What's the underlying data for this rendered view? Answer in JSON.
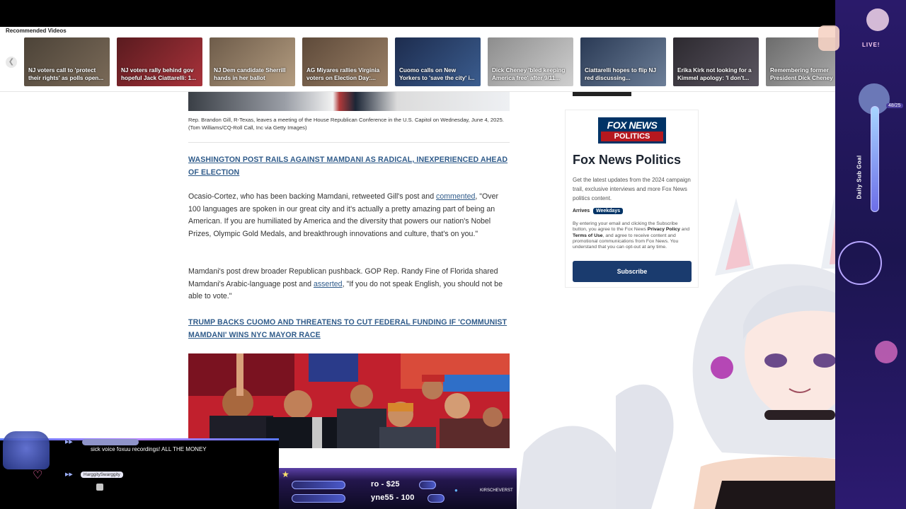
{
  "recommended": {
    "title": "Recommended Videos",
    "prev_icon": "chevron-left-icon",
    "items": [
      {
        "caption": "NJ voters call to 'protect their rights' as polls open...",
        "colors": [
          "#4c4338",
          "#7a6a58"
        ]
      },
      {
        "caption": "NJ voters rally behind gov hopeful Jack Ciattarelli: 1...",
        "colors": [
          "#5a1b1f",
          "#a8323a"
        ]
      },
      {
        "caption": "NJ Dem candidate Sherrill hands in her ballot",
        "colors": [
          "#6e5c4a",
          "#b39c80"
        ]
      },
      {
        "caption": "AG Miyares rallies Virginia voters on Election Day:...",
        "colors": [
          "#5e4a3a",
          "#9a8066"
        ]
      },
      {
        "caption": "Cuomo calls on New Yorkers to 'save the city' i...",
        "colors": [
          "#1d2c4e",
          "#3b5d8f"
        ]
      },
      {
        "caption": "Dick Cheney 'bled keeping America free' after 9/11...",
        "colors": [
          "#8d8d8d",
          "#cfcfcf"
        ]
      },
      {
        "caption": "Ciattarelli hopes to flip NJ red discussing...",
        "colors": [
          "#2a3a55",
          "#6d7f98"
        ]
      },
      {
        "caption": "Erika Kirk not looking for a Kimmel apology: 'I don't...",
        "colors": [
          "#2d2a30",
          "#5a5560"
        ]
      },
      {
        "caption": "Remembering former President Dick Cheney",
        "colors": [
          "#6c6c6c",
          "#b0b0b0"
        ]
      }
    ]
  },
  "article": {
    "photo_caption": "Rep. Brandon Gill, R-Texas, leaves a meeting of the House Republican Conference in the U.S. Capitol on Wednesday, June 4, 2025. (Tom Williams/CQ-Roll Call, Inc via Getty Images)",
    "link1": "WASHINGTON POST RAILS AGAINST MAMDANI AS RADICAL, INEXPERIENCED AHEAD OF ELECTION",
    "para1_before": "Ocasio-Cortez, who has been backing Mamdani, retweeted Gill's post and ",
    "para1_link": "commented",
    "para1_after": ", \"Over 100 languages are spoken in our great city and it's actually a pretty amazing part of being an American. If you are humiliated by America and the diversity that powers our nation's Nobel Prizes, Olympic Gold Medals, and breakthrough innovations and culture, that's on you.\"",
    "para2_before": "Mamdani's post drew broader Republican pushback. GOP Rep. Randy Fine of Florida shared Mamdani's Arabic-language post and ",
    "para2_link": "asserted",
    "para2_after": ", \"If you do not speak English, you should not be able to vote.\"",
    "link2": "TRUMP BACKS CUOMO AND THREATENS TO CUT FEDERAL FUNDING IF 'COMMUNIST MAMDANI' WINS NYC MAYOR RACE"
  },
  "sidebar": {
    "logo_line1": "FOX NEWS",
    "logo_line2": "POLITICS",
    "title": "Fox News Politics",
    "description": "Get the latest updates from the 2024 campaign trail, exclusive interviews and more Fox News politics content.",
    "arrives_label": "Arrives",
    "arrives_value": "Weekdays",
    "legal_1": "By entering your email and clicking the Subscribe button, you agree to the Fox News ",
    "legal_privacy": "Privacy Policy",
    "legal_2": " and ",
    "legal_terms": "Terms of Use",
    "legal_3": ", and agree to receive content and promotional communications from Fox News. You understand that you can opt-out at any time.",
    "subscribe_label": "Subscribe"
  },
  "stream": {
    "chat_message": "sick voice foxuu recordings! ALL THE MONEY",
    "chat_user": "HarggitySwarggity",
    "ticker_1": "ro - $25",
    "ticker_2": "yne55 - 100",
    "twitter_handle": "KIRSCHEVERST",
    "live_label": "LIVE!",
    "goal_label": "Daily Sub Goal",
    "goal_count": "48/25"
  }
}
